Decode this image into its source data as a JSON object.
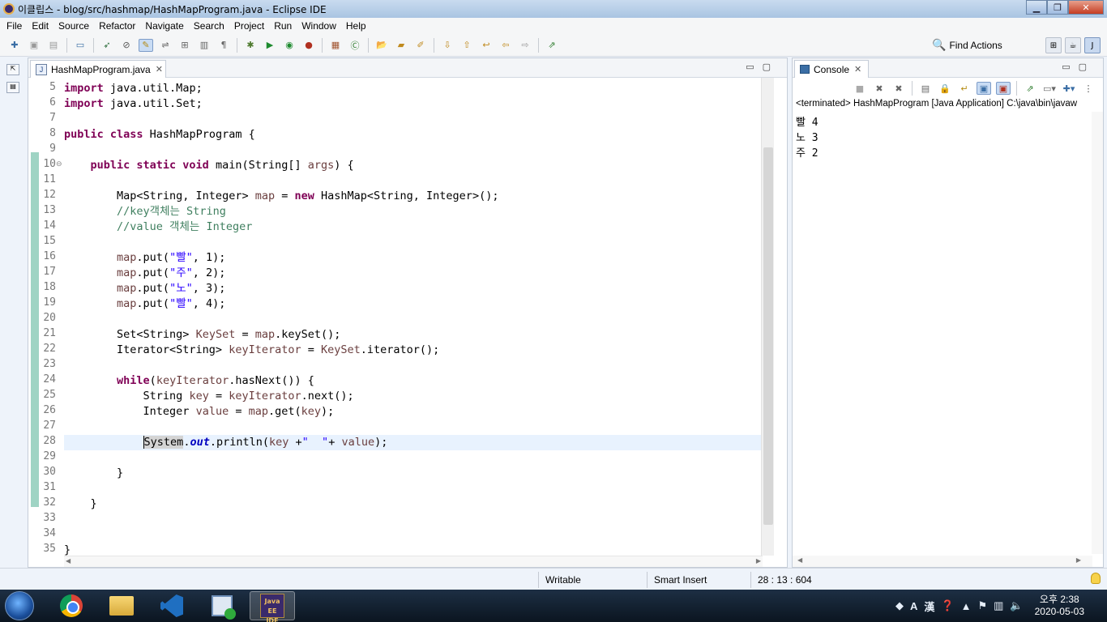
{
  "window": {
    "title": "이클립스 - blog/src/hashmap/HashMapProgram.java - Eclipse IDE"
  },
  "menu": [
    "File",
    "Edit",
    "Source",
    "Refactor",
    "Navigate",
    "Search",
    "Project",
    "Run",
    "Window",
    "Help"
  ],
  "toolbar": {
    "find_actions": "Find Actions"
  },
  "editor": {
    "tab_label": "HashMapProgram.java",
    "lines": [
      {
        "num": "5",
        "html": "<span class=\"kw\">import</span> java.util.Map;"
      },
      {
        "num": "6",
        "html": "<span class=\"kw\">import</span> java.util.Set;"
      },
      {
        "num": "7",
        "html": ""
      },
      {
        "num": "8",
        "html": "<span class=\"kw\">public class</span> HashMapProgram {"
      },
      {
        "num": "9",
        "html": ""
      },
      {
        "num": "10",
        "html": "    <span class=\"kw\">public static void</span> main(String[] <span class=\"var\">args</span>) {",
        "fold": true
      },
      {
        "num": "11",
        "html": ""
      },
      {
        "num": "12",
        "html": "        Map&lt;String, Integer&gt; <span class=\"var\">map</span> = <span class=\"kw\">new</span> HashMap&lt;String, Integer&gt;();"
      },
      {
        "num": "13",
        "html": "        <span class=\"cm\">//key객체는 String</span>"
      },
      {
        "num": "14",
        "html": "        <span class=\"cm\">//value 객체는 Integer</span>"
      },
      {
        "num": "15",
        "html": ""
      },
      {
        "num": "16",
        "html": "        <span class=\"var\">map</span>.put(<span class=\"st\">\"빨\"</span>, 1);"
      },
      {
        "num": "17",
        "html": "        <span class=\"var\">map</span>.put(<span class=\"st\">\"주\"</span>, 2);"
      },
      {
        "num": "18",
        "html": "        <span class=\"var\">map</span>.put(<span class=\"st\">\"노\"</span>, 3);"
      },
      {
        "num": "19",
        "html": "        <span class=\"var\">map</span>.put(<span class=\"st\">\"빨\"</span>, 4);"
      },
      {
        "num": "20",
        "html": ""
      },
      {
        "num": "21",
        "html": "        Set&lt;String&gt; <span class=\"var\">KeySet</span> = <span class=\"var\">map</span>.keySet();"
      },
      {
        "num": "22",
        "html": "        Iterator&lt;String&gt; <span class=\"var\">keyIterator</span> = <span class=\"var\">KeySet</span>.iterator();"
      },
      {
        "num": "23",
        "html": ""
      },
      {
        "num": "24",
        "html": "        <span class=\"kw\">while</span>(<span class=\"var\">keyIterator</span>.hasNext()) {"
      },
      {
        "num": "25",
        "html": "            String <span class=\"var\">key</span> = <span class=\"var\">keyIterator</span>.next();"
      },
      {
        "num": "26",
        "html": "            Integer <span class=\"var\">value</span> = <span class=\"var\">map</span>.get(<span class=\"var\">key</span>);"
      },
      {
        "num": "27",
        "html": ""
      },
      {
        "num": "28",
        "html": "            <span class=\"caret\"></span><span class=\"sys-hl\">System</span>.<span class=\"fld\">out</span>.println(<span class=\"var\">key</span> +<span class=\"st\">\"  \"</span>+ <span class=\"var\">value</span>);",
        "current": true
      },
      {
        "num": "29",
        "html": ""
      },
      {
        "num": "30",
        "html": "        }"
      },
      {
        "num": "31",
        "html": ""
      },
      {
        "num": "32",
        "html": "    }"
      },
      {
        "num": "33",
        "html": ""
      },
      {
        "num": "34",
        "html": ""
      },
      {
        "num": "35",
        "html": "}"
      }
    ]
  },
  "console": {
    "tab_label": "Console",
    "status": "<terminated> HashMapProgram [Java Application] C:\\java\\bin\\javaw",
    "output": [
      "빨 4",
      "노 3",
      "주 2"
    ]
  },
  "statusbar": {
    "writable": "Writable",
    "insert_mode": "Smart Insert",
    "position": "28 : 13 : 604"
  },
  "taskbar": {
    "eclipse_label": "Java EE IDE",
    "ime_a": "A",
    "ime_han": "漢",
    "time": "오후 2:38",
    "date": "2020-05-03"
  }
}
